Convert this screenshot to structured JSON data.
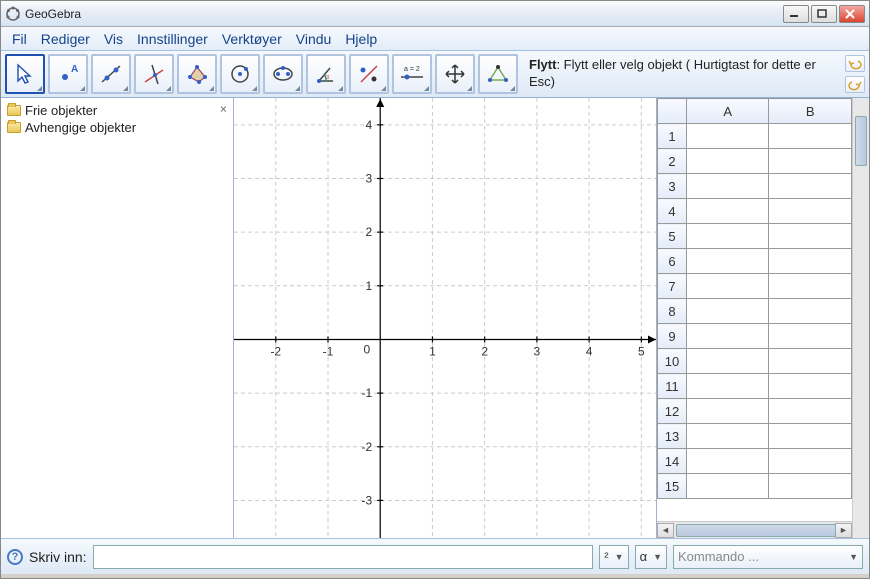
{
  "window": {
    "title": "GeoGebra"
  },
  "menu": {
    "items": [
      "Fil",
      "Rediger",
      "Vis",
      "Innstillinger",
      "Verktøyer",
      "Vindu",
      "Hjelp"
    ]
  },
  "toolbar": {
    "tool_name": "Flytt",
    "tool_text": ": Flytt eller velg objekt ( Hurtigtast for dette er Esc)"
  },
  "algebra": {
    "free_label": "Frie objekter",
    "dependent_label": "Avhengige objekter"
  },
  "spreadsheet": {
    "cols": [
      "A",
      "B"
    ],
    "rows": [
      1,
      2,
      3,
      4,
      5,
      6,
      7,
      8,
      9,
      10,
      11,
      12,
      13,
      14,
      15
    ]
  },
  "inputbar": {
    "label": "Skriv inn:",
    "exp_symbol": "²",
    "alpha_symbol": "α",
    "command_placeholder": "Kommando ..."
  },
  "chart_data": {
    "type": "scatter",
    "series": [],
    "xlabel": "",
    "ylabel": "",
    "x_ticks": [
      -2,
      -1,
      0,
      1,
      2,
      3,
      4,
      5
    ],
    "y_ticks": [
      -3,
      -2,
      -1,
      0,
      1,
      2,
      3,
      4
    ],
    "xlim": [
      -2.8,
      5.3
    ],
    "ylim": [
      -3.7,
      4.5
    ],
    "grid": true
  }
}
